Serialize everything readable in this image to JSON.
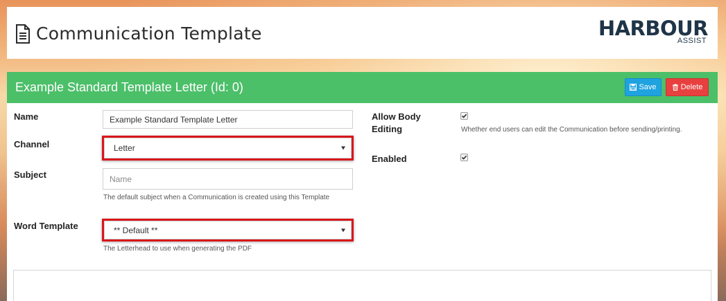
{
  "header": {
    "title": "Communication Template",
    "logo_main": "HARBOUR",
    "logo_sub": "ASSIST"
  },
  "card": {
    "title": "Example Standard Template Letter (Id: 0)",
    "save_label": "Save",
    "delete_label": "Delete",
    "header_color": "#4cbf69"
  },
  "form": {
    "name": {
      "label": "Name",
      "value": "Example Standard Template Letter"
    },
    "channel": {
      "label": "Channel",
      "selected": "Letter"
    },
    "subject": {
      "label": "Subject",
      "placeholder": "Name",
      "help": "The default subject when a Communication is created using this Template"
    },
    "word_template": {
      "label": "Word Template",
      "selected": "** Default **",
      "help": "The Letterhead to use when generating the PDF"
    },
    "allow_body_editing": {
      "label_line1": "Allow Body",
      "label_line2": "Editing",
      "checked": true,
      "help": "Whether end users can edit the Communication before sending/printing."
    },
    "enabled": {
      "label": "Enabled",
      "checked": true
    }
  },
  "colors": {
    "save_button": "#1fa3e0",
    "delete_button": "#e8403f",
    "highlight": "#d8171b"
  },
  "icons": {
    "title_icon": "document-icon",
    "save_icon": "floppy-disk-icon",
    "delete_icon": "trash-icon",
    "checkbox_icon": "checkmark-icon"
  }
}
